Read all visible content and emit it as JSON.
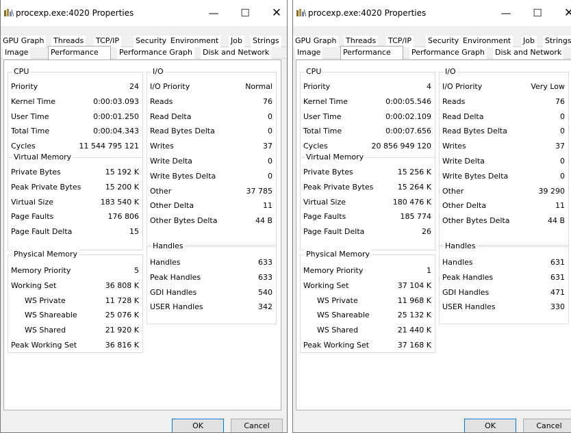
{
  "windows": [
    {
      "title": "procexp.exe:4020 Properties",
      "titlebar_controls": {
        "minimize": "—",
        "maximize": "☐",
        "close": "✕"
      },
      "tabs_row1": [
        "GPU Graph",
        "Threads",
        "TCP/IP",
        "Security",
        "Environment",
        "Job",
        "Strings"
      ],
      "tabs_row2": [
        "Image",
        "Performance",
        "Performance Graph",
        "Disk and Network"
      ],
      "active_tab": "Performance",
      "cpu": {
        "title": "CPU",
        "rows": [
          {
            "label": "Priority",
            "value": "24"
          },
          {
            "label": "Kernel Time",
            "value": "0:00:03.093"
          },
          {
            "label": "User Time",
            "value": "0:00:01.250"
          },
          {
            "label": "Total Time",
            "value": "0:00:04.343"
          },
          {
            "label": "Cycles",
            "value": "11 544 795 121"
          }
        ]
      },
      "virtual_memory": {
        "title": "Virtual Memory",
        "rows": [
          {
            "label": "Private Bytes",
            "value": "15 192 K"
          },
          {
            "label": "Peak Private Bytes",
            "value": "15 200 K"
          },
          {
            "label": "Virtual Size",
            "value": "183 540 K"
          },
          {
            "label": "Page Faults",
            "value": "176 806"
          },
          {
            "label": "Page Fault Delta",
            "value": "15"
          }
        ]
      },
      "physical_memory": {
        "title": "Physical Memory",
        "rows": [
          {
            "label": "Memory Priority",
            "value": "5"
          },
          {
            "label": "Working Set",
            "value": "36 808 K"
          },
          {
            "label": "WS Private",
            "value": "11 728 K"
          },
          {
            "label": "WS Shareable",
            "value": "25 076 K"
          },
          {
            "label": "WS Shared",
            "value": "21 920 K"
          },
          {
            "label": "Peak Working Set",
            "value": "36 816 K"
          }
        ]
      },
      "io": {
        "title": "I/O",
        "rows": [
          {
            "label": "I/O Priority",
            "value": "Normal"
          },
          {
            "label": "Reads",
            "value": "76"
          },
          {
            "label": "Read Delta",
            "value": "0"
          },
          {
            "label": "Read Bytes Delta",
            "value": "0"
          },
          {
            "label": "Writes",
            "value": "37"
          },
          {
            "label": "Write Delta",
            "value": "0"
          },
          {
            "label": "Write Bytes Delta",
            "value": "0"
          },
          {
            "label": "Other",
            "value": "37 785"
          },
          {
            "label": "Other Delta",
            "value": "11"
          },
          {
            "label": "Other Bytes Delta",
            "value": "44 B"
          }
        ]
      },
      "handles": {
        "title": "Handles",
        "rows": [
          {
            "label": "Handles",
            "value": "633"
          },
          {
            "label": "Peak Handles",
            "value": "633"
          },
          {
            "label": "GDI Handles",
            "value": "540"
          },
          {
            "label": "USER Handles",
            "value": "342"
          }
        ]
      },
      "buttons": {
        "ok": "OK",
        "cancel": "Cancel"
      }
    },
    {
      "title": "procexp.exe:4020 Properties",
      "titlebar_controls": {
        "minimize": "—",
        "maximize": "☐",
        "close": "✕"
      },
      "tabs_row1": [
        "GPU Graph",
        "Threads",
        "TCP/IP",
        "Security",
        "Environment",
        "Job",
        "Strings"
      ],
      "tabs_row2": [
        "Image",
        "Performance",
        "Performance Graph",
        "Disk and Network"
      ],
      "active_tab": "Performance",
      "cpu": {
        "title": "CPU",
        "rows": [
          {
            "label": "Priority",
            "value": "4"
          },
          {
            "label": "Kernel Time",
            "value": "0:00:05.546"
          },
          {
            "label": "User Time",
            "value": "0:00:02.109"
          },
          {
            "label": "Total Time",
            "value": "0:00:07.656"
          },
          {
            "label": "Cycles",
            "value": "20 856 949 120"
          }
        ]
      },
      "virtual_memory": {
        "title": "Virtual Memory",
        "rows": [
          {
            "label": "Private Bytes",
            "value": "15 256 K"
          },
          {
            "label": "Peak Private Bytes",
            "value": "15 264 K"
          },
          {
            "label": "Virtual Size",
            "value": "180 476 K"
          },
          {
            "label": "Page Faults",
            "value": "185 774"
          },
          {
            "label": "Page Fault Delta",
            "value": "26"
          }
        ]
      },
      "physical_memory": {
        "title": "Physical Memory",
        "rows": [
          {
            "label": "Memory Priority",
            "value": "1"
          },
          {
            "label": "Working Set",
            "value": "37 104 K"
          },
          {
            "label": "WS Private",
            "value": "11 968 K"
          },
          {
            "label": "WS Shareable",
            "value": "25 132 K"
          },
          {
            "label": "WS Shared",
            "value": "21 440 K"
          },
          {
            "label": "Peak Working Set",
            "value": "37 168 K"
          }
        ]
      },
      "io": {
        "title": "I/O",
        "rows": [
          {
            "label": "I/O Priority",
            "value": "Very Low"
          },
          {
            "label": "Reads",
            "value": "76"
          },
          {
            "label": "Read Delta",
            "value": "0"
          },
          {
            "label": "Read Bytes Delta",
            "value": "0"
          },
          {
            "label": "Writes",
            "value": "37"
          },
          {
            "label": "Write Delta",
            "value": "0"
          },
          {
            "label": "Write Bytes Delta",
            "value": "0"
          },
          {
            "label": "Other",
            "value": "39 290"
          },
          {
            "label": "Other Delta",
            "value": "11"
          },
          {
            "label": "Other Bytes Delta",
            "value": "44 B"
          }
        ]
      },
      "handles": {
        "title": "Handles",
        "rows": [
          {
            "label": "Handles",
            "value": "631"
          },
          {
            "label": "Peak Handles",
            "value": "631"
          },
          {
            "label": "GDI Handles",
            "value": "471"
          },
          {
            "label": "USER Handles",
            "value": "330"
          }
        ]
      },
      "buttons": {
        "ok": "OK",
        "cancel": "Cancel"
      }
    }
  ]
}
